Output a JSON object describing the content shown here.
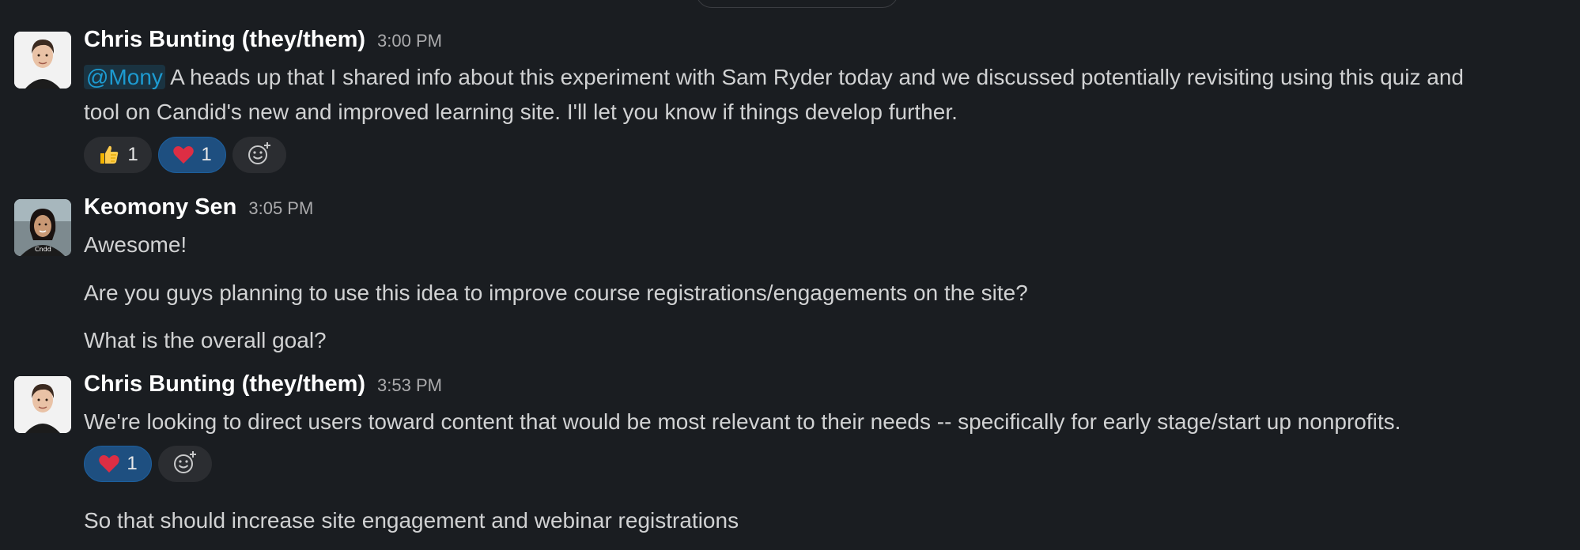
{
  "messages": [
    {
      "author": "Chris Bunting (they/them)",
      "time": "3:00 PM",
      "mention": "@Mony",
      "line1_rest": " A heads up that I shared info about this experiment with Sam Ryder today and we discussed potentially revisiting using this quiz and",
      "line2": "tool on Candid's new and improved learning site. I'll let you know if things develop further.",
      "reactions": [
        {
          "emoji": "thumbs-up",
          "count": "1",
          "active": false
        },
        {
          "emoji": "heart",
          "count": "1",
          "active": true
        }
      ]
    },
    {
      "author": "Keomony Sen",
      "time": "3:05 PM",
      "lines": [
        "Awesome!",
        "Are you guys planning to use this idea to improve course registrations/engagements on the site?",
        "What is the overall goal?"
      ]
    },
    {
      "author": "Chris Bunting (they/them)",
      "time": "3:53 PM",
      "line1": "We're looking to direct users toward content that would be most relevant to their needs -- specifically for early stage/start up nonprofits.",
      "reactions": [
        {
          "emoji": "heart",
          "count": "1",
          "active": true
        }
      ],
      "followup": "So that should increase site engagement and webinar registrations"
    }
  ],
  "colors": {
    "background": "#1a1d21",
    "mention": "#1d9bd1",
    "reaction_active": "#1e4f80",
    "reaction": "#2b2d31"
  },
  "icons": {
    "add_reaction": "add-reaction-icon",
    "thumbs_up": "thumbs-up-icon",
    "heart": "heart-icon"
  }
}
